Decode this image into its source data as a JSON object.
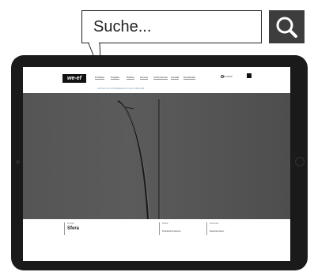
{
  "search": {
    "placeholder": "Suche..."
  },
  "tablet_screen": {
    "logo": "we-ef",
    "nav": [
      "Produkte",
      "Projekte",
      "Wissen",
      "Service",
      "Unternehmen",
      "Kontakt",
      "Downloads"
    ],
    "lang": "Deutsch",
    "breadcrumb": "‹ Zurück zum Produktbereich in der Übersicht",
    "footer": {
      "col1_small": "Produkt",
      "col1_big": "Sfera",
      "col2_small": "Details",
      "col2_value": "Produktinformationen",
      "col3_small": "Download",
      "col3_value": "Datenblatt laden"
    }
  },
  "colors": {
    "search_button": "#3d3d3d",
    "tablet_frame": "#1a1a1a",
    "hero": "#555555"
  },
  "icons": {
    "search": "search-icon"
  }
}
